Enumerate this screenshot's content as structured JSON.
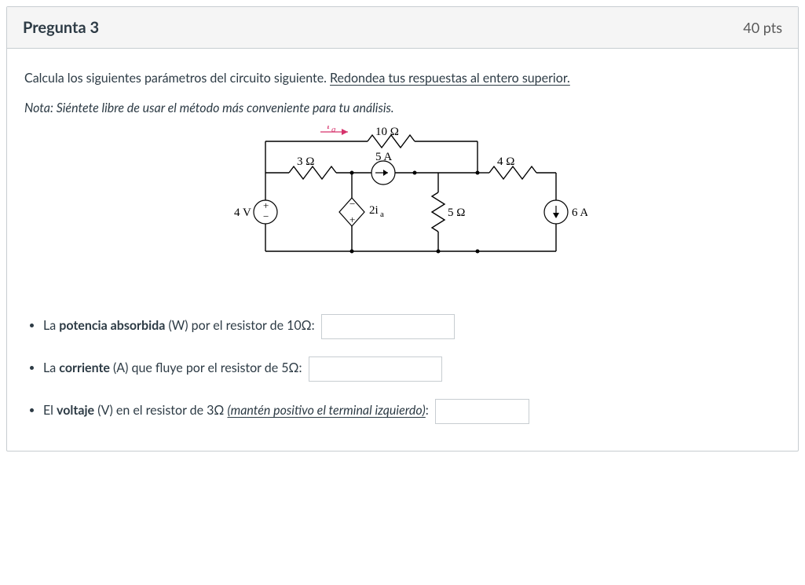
{
  "header": {
    "title": "Pregunta 3",
    "points": "40 pts"
  },
  "prompt": {
    "lead": "Calcula los siguientes parámetros del circuito siguiente. ",
    "strong": "Redondea tus respuestas al entero superior."
  },
  "note": "Nota: Siéntete libre de usar el método más conveniente para tu análisis.",
  "circuit": {
    "ia": "i",
    "ia_sub": "a",
    "r10": "10 Ω",
    "r3": "3 Ω",
    "r4": "4 Ω",
    "r5": "5 Ω",
    "i5a": "5 A",
    "twoia": "2i",
    "twoia_sub": "a",
    "v4": "4 V",
    "i6a": "6 A",
    "plus": "+",
    "minus": "−"
  },
  "answers": {
    "a1_pre": "La ",
    "a1_strong": "potencia absorbida",
    "a1_post": " (W) por el resistor de 10Ω:",
    "a2_pre": "La ",
    "a2_strong": "corriente",
    "a2_post": " (A) que fluye por el resistor de 5Ω:",
    "a3_pre": "El ",
    "a3_strong": "voltaje",
    "a3_mid": " (V) en el resistor de 3Ω ",
    "a3_em": "(mantén positivo el terminal izquierdo)",
    "a3_post": ":"
  }
}
